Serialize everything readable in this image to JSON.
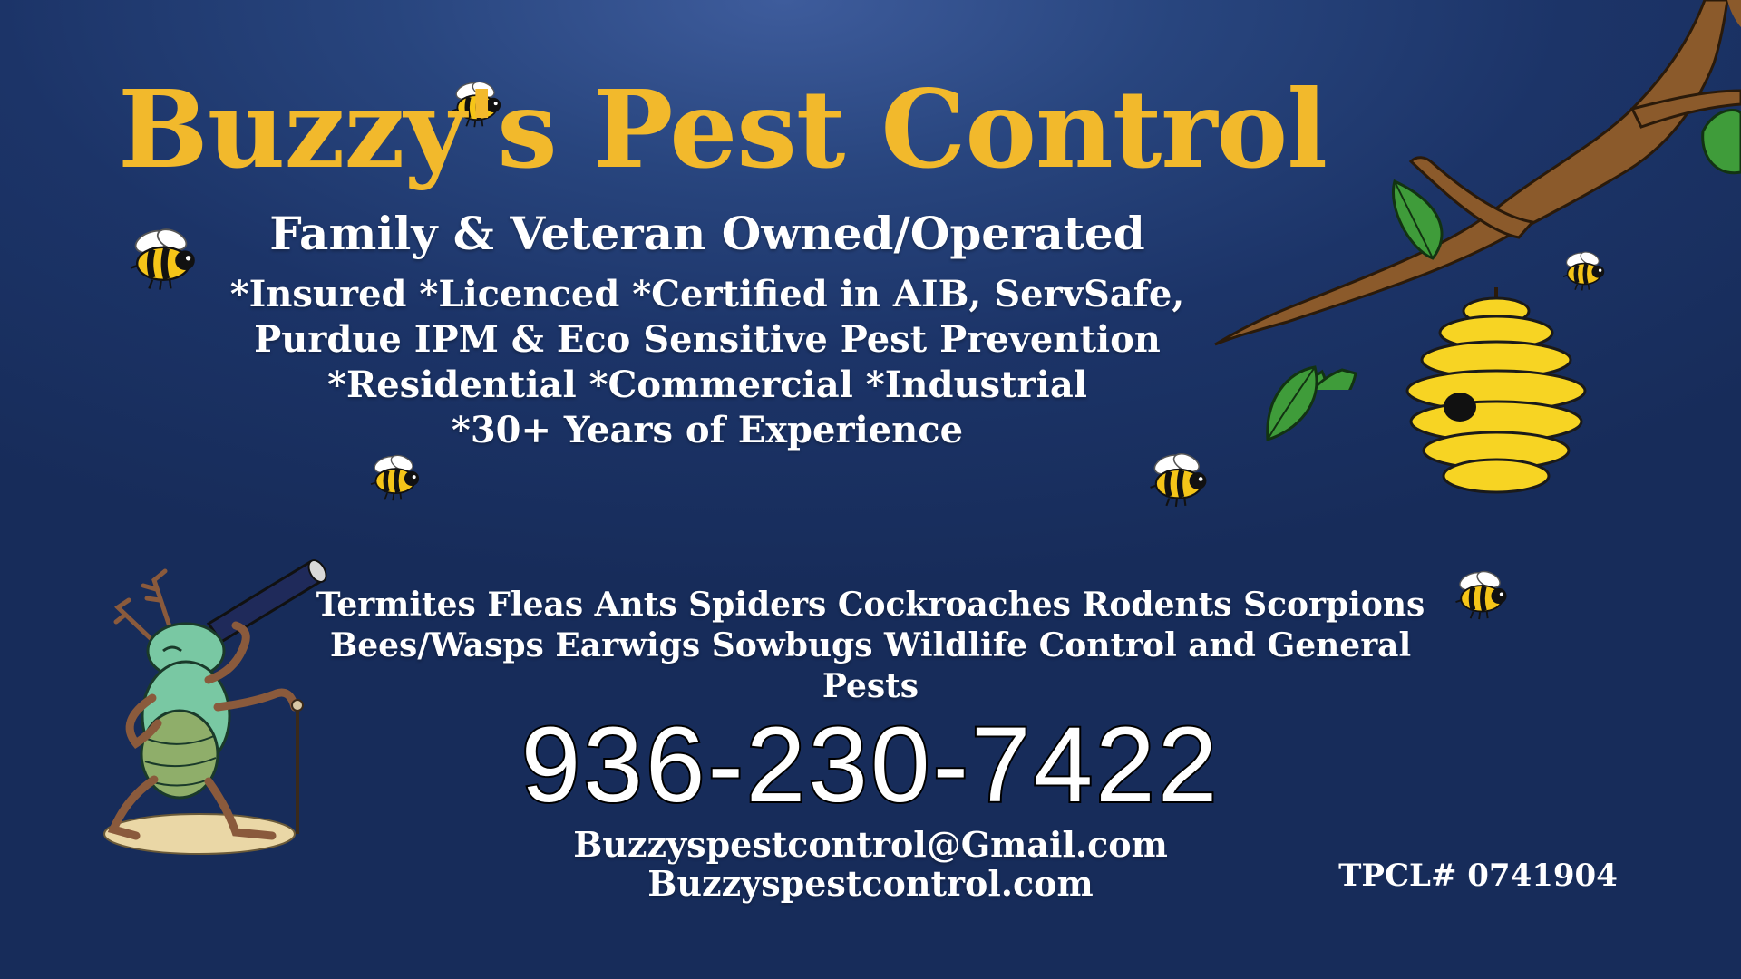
{
  "business": {
    "name": "Buzzy's Pest Control",
    "tagline": "Family & Veteran Owned/Operated"
  },
  "credentials": [
    "*Insured *Licenced *Certified in AIB, ServSafe,",
    "Purdue IPM & Eco Sensitive Pest Prevention",
    "*Residential *Commercial *Industrial",
    "*30+ Years of Experience"
  ],
  "services": [
    "Termites Fleas Ants Spiders Cockroaches Rodents Scorpions",
    "Bees/Wasps Earwigs Sowbugs Wildlife Control and General",
    "Pests"
  ],
  "contact": {
    "phone": "936-230-7422",
    "email": "Buzzyspestcontrol@Gmail.com",
    "website": "Buzzyspestcontrol.com"
  },
  "license": "TPCL# 0741904",
  "colors": {
    "title": "#f2b92c",
    "text": "#ffffff",
    "background": "#1c3468",
    "hive": "#f7d423",
    "branch": "#8b5a2b",
    "leaf": "#3f9c3a"
  },
  "decorations": {
    "tree": "tree-branch-icon",
    "hive": "beehive-icon",
    "bee": "bee-icon",
    "bug": "cartoon-bug-with-telescope-icon"
  }
}
